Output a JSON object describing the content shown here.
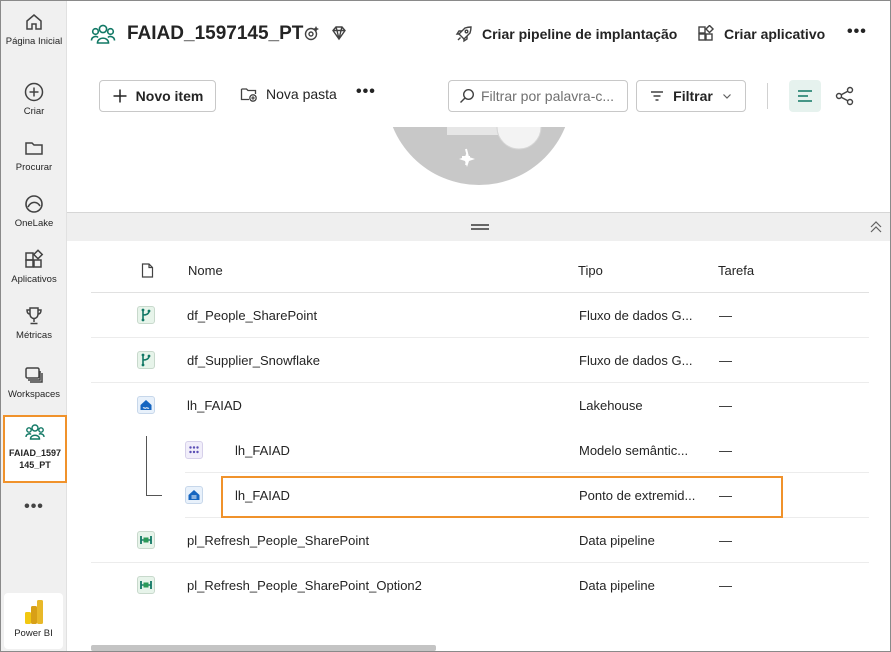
{
  "rail": {
    "items": [
      {
        "label": "Página Inicial",
        "icon": "home-icon"
      },
      {
        "label": "Criar",
        "icon": "create-icon"
      },
      {
        "label": "Procurar",
        "icon": "folder-icon"
      },
      {
        "label": "OneLake",
        "icon": "onelake-icon"
      },
      {
        "label": "Aplicativos",
        "icon": "apps-icon"
      },
      {
        "label": "Métricas",
        "icon": "trophy-icon"
      },
      {
        "label": "Workspaces",
        "icon": "workspaces-icon"
      },
      {
        "label": "FAIAD_1597145_PT",
        "icon": "workspace-people-icon"
      }
    ],
    "more": "•••",
    "powerbi_label": "Power BI"
  },
  "header": {
    "title": "FAIAD_1597145_PT",
    "create_pipeline": "Criar pipeline de implantação",
    "create_app": "Criar aplicativo",
    "more": "•••"
  },
  "toolbar": {
    "new_item": "Novo item",
    "new_folder": "Nova pasta",
    "more": "•••",
    "search_placeholder": "Filtrar por palavra-c...",
    "filter": "Filtrar"
  },
  "table": {
    "columns": {
      "name": "Nome",
      "type": "Tipo",
      "task": "Tarefa"
    },
    "rows": [
      {
        "name": "df_People_SharePoint",
        "type": "Fluxo de dados G...",
        "task": "—",
        "icon": "dataflow-icon"
      },
      {
        "name": "df_Supplier_Snowflake",
        "type": "Fluxo de dados G...",
        "task": "—",
        "icon": "dataflow-icon"
      },
      {
        "name": "lh_FAIAD",
        "type": "Lakehouse",
        "task": "—",
        "icon": "lakehouse-icon"
      },
      {
        "name": "lh_FAIAD",
        "type": "Modelo semântic...",
        "task": "—",
        "icon": "semantic-model-icon"
      },
      {
        "name": "lh_FAIAD",
        "type": "Ponto de extremid...",
        "task": "—",
        "icon": "sql-endpoint-icon"
      },
      {
        "name": "pl_Refresh_People_SharePoint",
        "type": "Data pipeline",
        "task": "—",
        "icon": "pipeline-icon"
      },
      {
        "name": "pl_Refresh_People_SharePoint_Option2",
        "type": "Data pipeline",
        "task": "—",
        "icon": "pipeline-icon"
      }
    ]
  },
  "colors": {
    "accent_green": "#117865",
    "highlight_orange": "#f0922b",
    "rail_bg": "#f0f0f0"
  }
}
